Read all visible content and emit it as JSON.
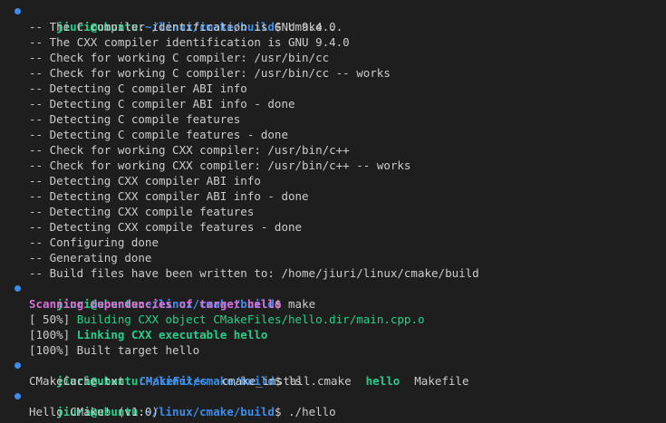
{
  "prompt": {
    "user_host": "jiuri@ubuntu",
    "sep": ":",
    "path": "~/linux/cmake/build",
    "symbol": "$ "
  },
  "commands": [
    "cmake ..",
    "make",
    "ls",
    "./hello"
  ],
  "cmake_output": [
    "-- The C compiler identification is GNU 9.4.0",
    "-- The CXX compiler identification is GNU 9.4.0",
    "-- Check for working C compiler: /usr/bin/cc",
    "-- Check for working C compiler: /usr/bin/cc -- works",
    "-- Detecting C compiler ABI info",
    "-- Detecting C compiler ABI info - done",
    "-- Detecting C compile features",
    "-- Detecting C compile features - done",
    "-- Check for working CXX compiler: /usr/bin/c++",
    "-- Check for working CXX compiler: /usr/bin/c++ -- works",
    "-- Detecting CXX compiler ABI info",
    "-- Detecting CXX compiler ABI info - done",
    "-- Detecting CXX compile features",
    "-- Detecting CXX compile features - done",
    "-- Configuring done",
    "-- Generating done",
    "-- Build files have been written to: /home/jiuri/linux/cmake/build"
  ],
  "make_output": {
    "scanning": "Scanning dependencies of target hello",
    "building_pct": "[ 50%] ",
    "building_text": "Building CXX object CMakeFiles/hello.dir/main.cpp.o",
    "linking_pct": "[100%] ",
    "linking_text": "Linking CXX executable hello",
    "built": "[100%] Built target hello"
  },
  "ls_output": {
    "file1": "CMakeCache.txt",
    "dir1": "CMakeFiles",
    "file2": "cmake_install.cmake",
    "exe1": "hello",
    "file3": "Makefile"
  },
  "hello_output": "Hello CMake! (v1.0)",
  "colors": {
    "background": "#1e1e1e",
    "text": "#cccccc",
    "user_green": "#23d18b",
    "path_blue": "#3b8eea",
    "magenta": "#d670d6",
    "dot_blue": "#3b8eea"
  }
}
